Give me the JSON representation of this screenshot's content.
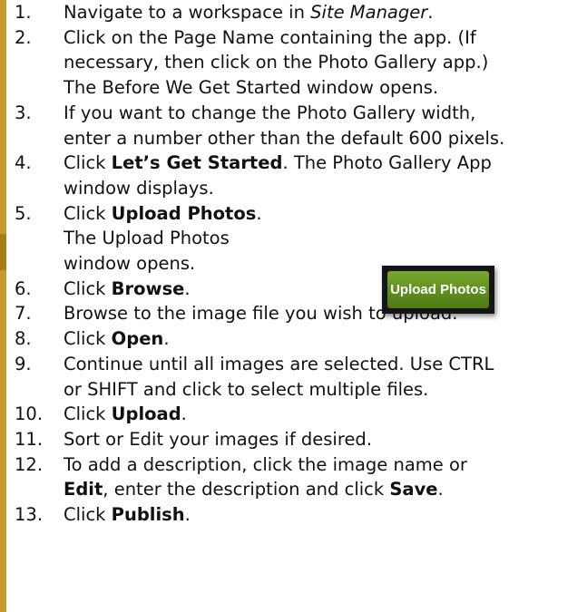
{
  "steps": [
    {
      "num": "1.",
      "lines": [
        [
          "Navigate to a workspace in ",
          {
            "i": "Site Manager"
          },
          "."
        ]
      ]
    },
    {
      "num": "2.",
      "lines": [
        [
          "Click on the Page Name containing the app. (If"
        ],
        [
          "necessary, then click on the Photo Gallery app.)"
        ],
        [
          "The Before We Get Started window opens."
        ]
      ]
    },
    {
      "num": "3.",
      "lines": [
        [
          "If you want to change the Photo Gallery width,"
        ],
        [
          "enter a number other than the default 600 pixels."
        ]
      ]
    },
    {
      "num": "4.",
      "lines": [
        [
          "Click ",
          {
            "b": "Let’s Get Started"
          },
          ". The Photo Gallery App"
        ],
        [
          "window displays."
        ]
      ]
    },
    {
      "num": "5.",
      "lines": [
        [
          "Click ",
          {
            "b": "Upload Photos"
          },
          "."
        ],
        [
          "The Upload Photos"
        ],
        [
          "window opens."
        ]
      ]
    },
    {
      "num": "6.",
      "lines": [
        [
          "Click ",
          {
            "b": "Browse"
          },
          "."
        ]
      ]
    },
    {
      "num": "7.",
      "lines": [
        [
          "Browse to the image file you wish to upload."
        ]
      ]
    },
    {
      "num": "8.",
      "lines": [
        [
          "Click ",
          {
            "b": "Open"
          },
          "."
        ]
      ]
    },
    {
      "num": "9.",
      "lines": [
        [
          "Continue until all images are selected. Use CTRL"
        ],
        [
          "or SHIFT and click to select multiple files."
        ]
      ]
    },
    {
      "num": "10.",
      "lines": [
        [
          "Click ",
          {
            "b": "Upload"
          },
          "."
        ]
      ]
    },
    {
      "num": "11.",
      "lines": [
        [
          "Sort or Edit your images if desired."
        ]
      ]
    },
    {
      "num": "12.",
      "lines": [
        [
          "To add a description, click the image name or"
        ],
        [
          {
            "b": "Edit"
          },
          ", enter the description and click ",
          {
            "b": "Save"
          },
          "."
        ]
      ]
    },
    {
      "num": "13.",
      "lines": [
        [
          "Click ",
          {
            "b": "Publish"
          },
          "."
        ]
      ]
    }
  ],
  "upload_button": {
    "label": "Upload Photos"
  },
  "colors": {
    "bar": "#c49a2c",
    "bar_dark": "#a87c12",
    "button_green": "#5f8d1e",
    "button_frame": "#151515"
  }
}
